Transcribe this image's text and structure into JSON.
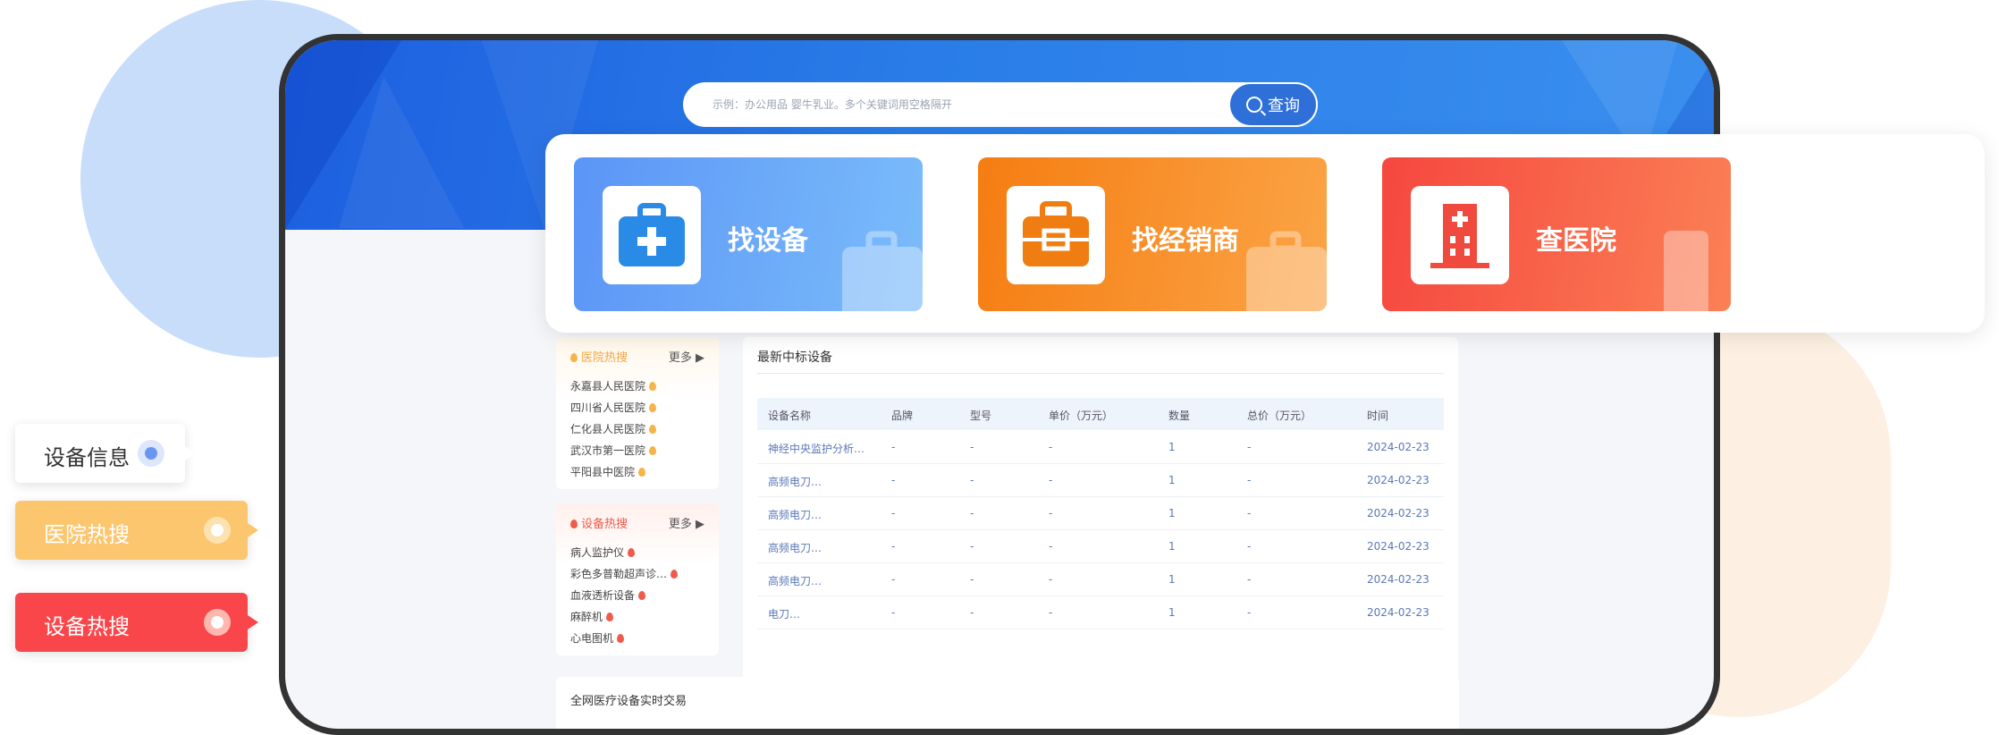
{
  "search": {
    "placeholder": "示例：办公用品 婴牛乳业。多个关键词用空格隔开",
    "button_label": "查询"
  },
  "cards": [
    {
      "label": "找设备",
      "icon": "medkit-icon",
      "color_from": "#5b95f7",
      "color_to": "#7bbcfa"
    },
    {
      "label": "找经销商",
      "icon": "briefcase-icon",
      "color_from": "#f57d12",
      "color_to": "#fba446"
    },
    {
      "label": "查医院",
      "icon": "hospital-icon",
      "color_from": "#f5473f",
      "color_to": "#fb8055"
    }
  ],
  "hospital_hot": {
    "title": "医院热搜",
    "more": "更多",
    "items": [
      "永嘉县人民医院",
      "四川省人民医院",
      "仁化县人民医院",
      "武汉市第一医院",
      "平阳县中医院"
    ]
  },
  "device_hot": {
    "title": "设备热搜",
    "more": "更多",
    "items": [
      "病人监护仪",
      "彩色多普勒超声诊…",
      "血液透析设备",
      "麻醉机",
      "心电图机"
    ]
  },
  "latest": {
    "title": "最新中标设备",
    "columns": [
      "设备名称",
      "品牌",
      "型号",
      "单价（万元）",
      "数量",
      "总价（万元）",
      "时间"
    ],
    "rows": [
      [
        "神经中央监护分析…",
        "-",
        "-",
        "-",
        "1",
        "-",
        "2024-02-23"
      ],
      [
        "高频电刀…",
        "-",
        "-",
        "-",
        "1",
        "-",
        "2024-02-23"
      ],
      [
        "高频电刀…",
        "-",
        "-",
        "-",
        "1",
        "-",
        "2024-02-23"
      ],
      [
        "高频电刀…",
        "-",
        "-",
        "-",
        "1",
        "-",
        "2024-02-23"
      ],
      [
        "高频电刀…",
        "-",
        "-",
        "-",
        "1",
        "-",
        "2024-02-23"
      ],
      [
        "电刀…",
        "-",
        "-",
        "-",
        "1",
        "-",
        "2024-02-23"
      ]
    ]
  },
  "realtime": {
    "title": "全网医疗设备实时交易"
  },
  "tags": [
    {
      "label": "设备信息",
      "bg": "#ffffff",
      "text": "#333333",
      "dot": "#6b96f0"
    },
    {
      "label": "医院热搜",
      "bg": "#fcc66f",
      "text": "#ffffff",
      "dot": "#fde2b0"
    },
    {
      "label": "设备热搜",
      "bg": "#f9464a",
      "text": "#ffffff",
      "dot": "#ffb8b0"
    }
  ]
}
